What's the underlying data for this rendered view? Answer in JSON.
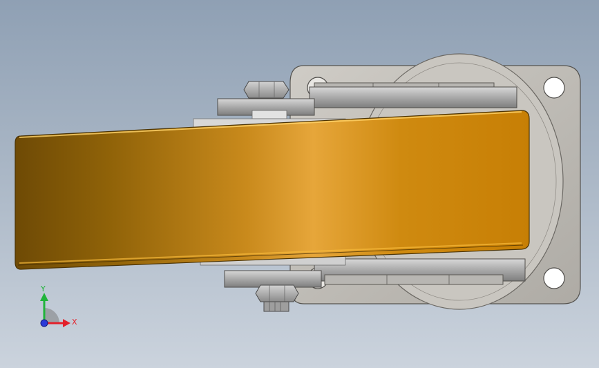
{
  "viewport": {
    "background_top": "#8fa0b4",
    "background_bottom": "#cbd3dd"
  },
  "model": {
    "wheel_tread_color": "#e0a02a",
    "wheel_shadow_color": "#6e4a05",
    "bracket_color": "#bcbcbc",
    "plate_color": "#c4c1bb"
  },
  "triad": {
    "x_label": "X",
    "y_label": "Y",
    "x_color": "#e3202a",
    "y_color": "#20b43a",
    "z_color": "#2a3ad8"
  }
}
